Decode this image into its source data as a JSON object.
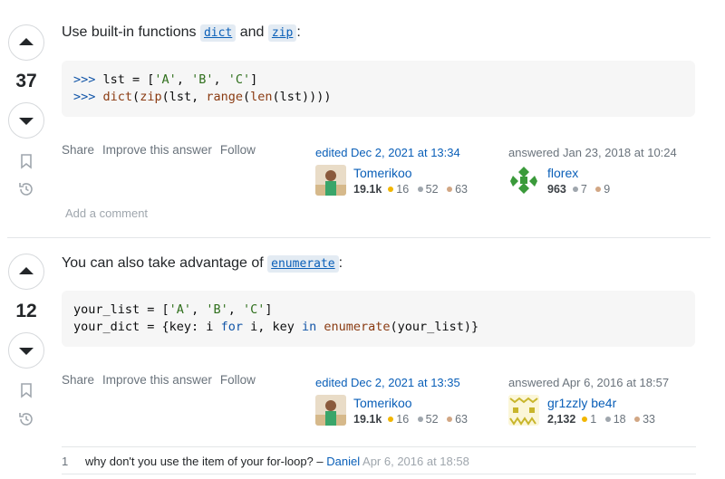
{
  "answers": [
    {
      "score": "37",
      "intro": {
        "before": "Use built-in functions",
        "code1": "dict",
        "and": "and",
        "code2": "zip",
        "after": ":"
      },
      "code_lines": [
        ">>> lst = ['A', 'B', 'C']",
        ">>> dict(zip(lst, range(len(lst))))"
      ],
      "menu": [
        "Share",
        "Improve this answer",
        "Follow"
      ],
      "edited": {
        "action": "edited Dec 2, 2021 at 13:34",
        "user": "Tomerikoo",
        "rep": "19.1k",
        "gold": "16",
        "silver": "52",
        "bronze": "63"
      },
      "answered": {
        "action": "answered Jan 23, 2018 at 10:24",
        "user": "florex",
        "rep": "963",
        "silver": "7",
        "bronze": "9"
      },
      "add_comment": "Add a comment"
    },
    {
      "score": "12",
      "intro": {
        "before": "You can also take advantage of",
        "code1": "enumerate",
        "after": ":"
      },
      "code_lines": [
        "your_list = ['A', 'B', 'C']",
        "your_dict = {key: i for i, key in enumerate(your_list)}"
      ],
      "menu": [
        "Share",
        "Improve this answer",
        "Follow"
      ],
      "edited": {
        "action": "edited Dec 2, 2021 at 13:35",
        "user": "Tomerikoo",
        "rep": "19.1k",
        "gold": "16",
        "silver": "52",
        "bronze": "63"
      },
      "answered": {
        "action": "answered Apr 6, 2016 at 18:57",
        "user": "gr1zzly be4r",
        "rep": "2,132",
        "gold": "1",
        "silver": "18",
        "bronze": "33"
      },
      "comment": {
        "score": "1",
        "text": "why don't you use the item of your for-loop? –",
        "user": "Daniel",
        "date": "Apr 6, 2016 at 18:58"
      }
    }
  ],
  "colors": {
    "link": "#0a5fb8",
    "gold": "#f1b600",
    "silver": "#9fa6ad",
    "bronze": "#d1a684"
  },
  "icons": [
    "upvote-icon",
    "downvote-icon",
    "bookmark-icon",
    "history-icon"
  ]
}
